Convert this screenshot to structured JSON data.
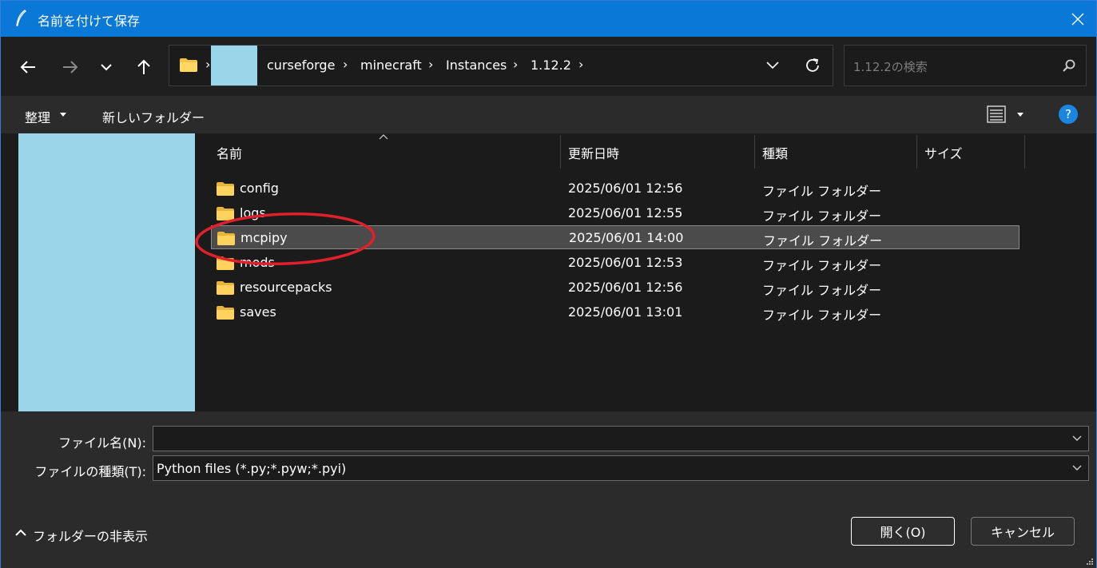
{
  "window": {
    "title": "名前を付けて保存"
  },
  "nav": {
    "breadcrumbs": [
      "curseforge",
      "minecraft",
      "Instances",
      "1.12.2"
    ],
    "search_placeholder": "1.12.2の検索"
  },
  "toolbar": {
    "organize_label": "整理",
    "new_folder_label": "新しいフォルダー"
  },
  "filelist": {
    "columns": {
      "name": "名前",
      "date": "更新日時",
      "type": "種類",
      "size": "サイズ"
    },
    "rows": [
      {
        "name": "config",
        "date": "2025/06/01 12:56",
        "type": "ファイル フォルダー",
        "selected": false
      },
      {
        "name": "logs",
        "date": "2025/06/01 12:55",
        "type": "ファイル フォルダー",
        "selected": false
      },
      {
        "name": "mcpipy",
        "date": "2025/06/01 14:00",
        "type": "ファイル フォルダー",
        "selected": true
      },
      {
        "name": "mods",
        "date": "2025/06/01 12:53",
        "type": "ファイル フォルダー",
        "selected": false
      },
      {
        "name": "resourcepacks",
        "date": "2025/06/01 12:56",
        "type": "ファイル フォルダー",
        "selected": false
      },
      {
        "name": "saves",
        "date": "2025/06/01 13:01",
        "type": "ファイル フォルダー",
        "selected": false
      }
    ]
  },
  "bottom": {
    "filename_label": "ファイル名(N):",
    "filename_value": "",
    "filetype_label": "ファイルの種類(T):",
    "filetype_value": "Python files (*.py;*.pyw;*.pyi)",
    "hide_folders_label": "フォルダーの非表示",
    "open_button": "開く(O)",
    "cancel_button": "キャンセル"
  },
  "colors": {
    "titlebar": "#0a78d6",
    "annotation": "#e0202a",
    "redaction": "#9ad6ea",
    "folder": "#f5c542"
  },
  "icons": [
    "feather-icon",
    "close-icon",
    "back-arrow-icon",
    "forward-arrow-icon",
    "chevron-down-icon",
    "up-arrow-icon",
    "folder-icon",
    "refresh-icon",
    "search-icon",
    "view-list-icon",
    "help-icon",
    "resize-grip-icon"
  ]
}
